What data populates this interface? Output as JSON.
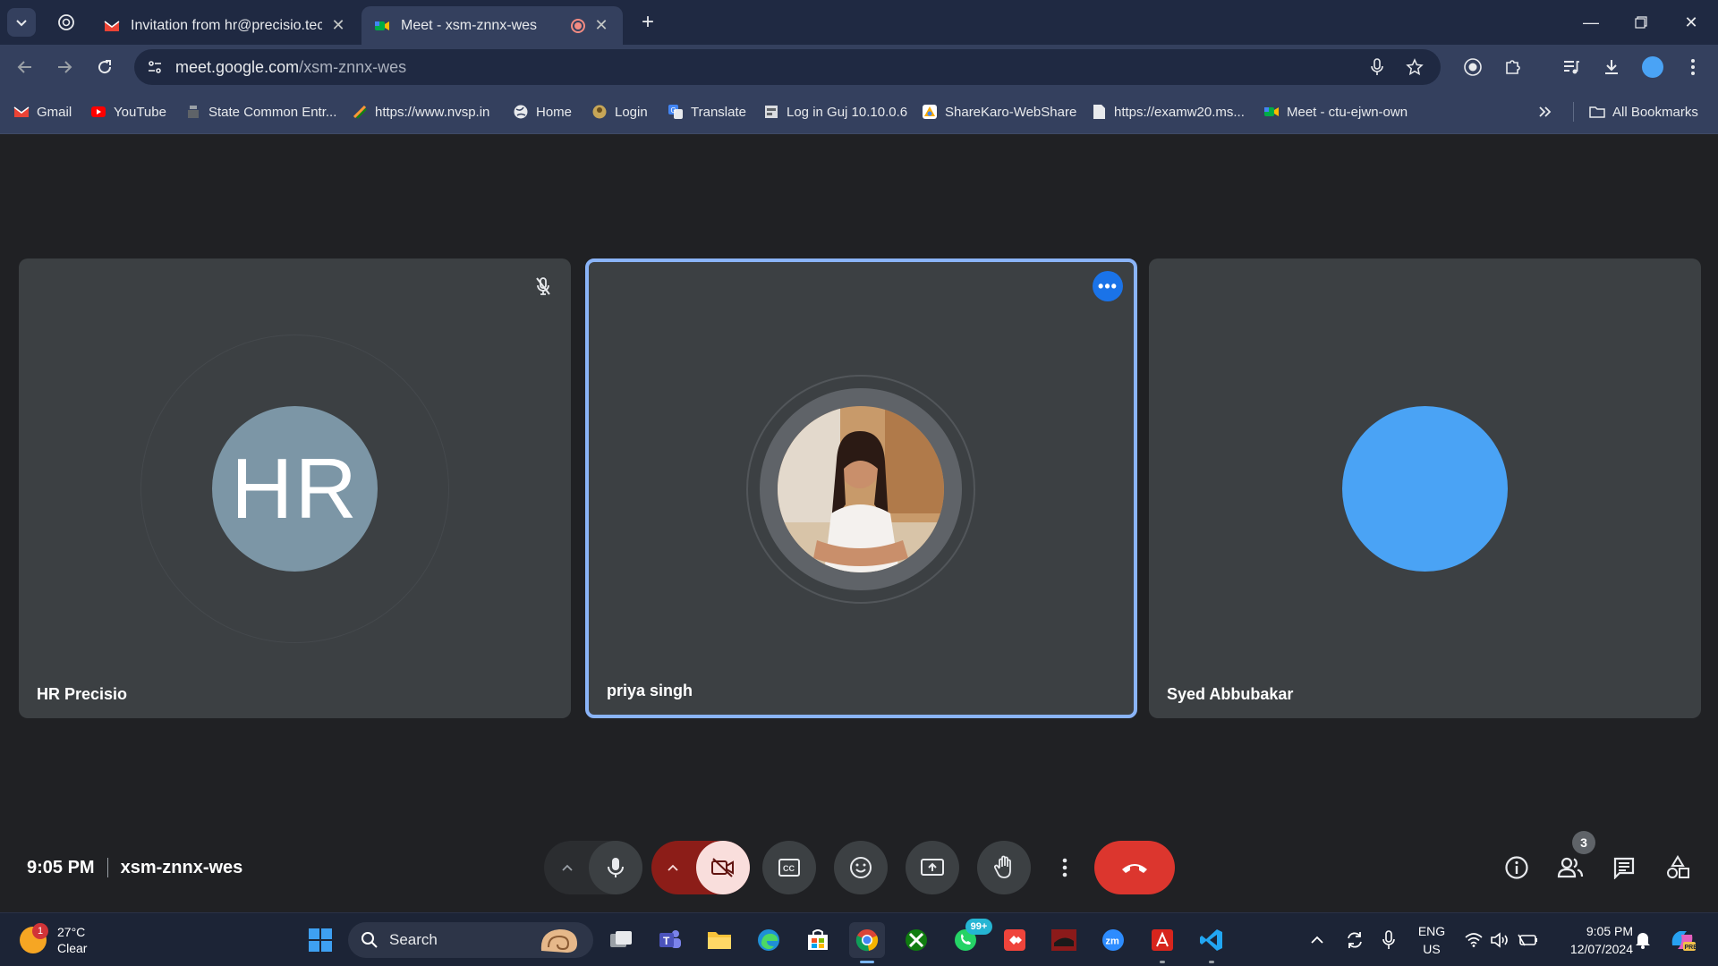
{
  "browser": {
    "tabs": [
      {
        "title": "Invitation from hr@precisio.tech",
        "favicon": "gmail-icon"
      },
      {
        "title": "Meet - xsm-znnx-wes",
        "favicon": "google-meet-icon",
        "recording": true
      }
    ],
    "url_host": "meet.google.com",
    "url_path": "/xsm-znnx-wes",
    "bookmarks": [
      {
        "label": "Gmail",
        "icon": "gmail-icon"
      },
      {
        "label": "YouTube",
        "icon": "youtube-icon"
      },
      {
        "label": "State Common Entr...",
        "icon": "emblem-icon"
      },
      {
        "label": "https://www.nvsp.in",
        "icon": "nvsp-icon"
      },
      {
        "label": "Home",
        "icon": "globe-icon"
      },
      {
        "label": "Login",
        "icon": "login-icon"
      },
      {
        "label": "Translate",
        "icon": "translate-icon"
      },
      {
        "label": "Log in Guj 10.10.0.6",
        "icon": "page-icon"
      },
      {
        "label": "ShareKaro-WebShare",
        "icon": "sharekaro-icon"
      },
      {
        "label": "https://examw20.ms...",
        "icon": "doc-icon"
      },
      {
        "label": "Meet - ctu-ejwn-own",
        "icon": "google-meet-icon"
      }
    ],
    "all_bookmarks_label": "All Bookmarks"
  },
  "meet": {
    "participants": [
      {
        "name": "HR Precisio",
        "initials": "HR",
        "muted": true
      },
      {
        "name": "priya singh",
        "active_speaker": true
      },
      {
        "name": "Syed Abbubakar"
      }
    ],
    "time": "9:05 PM",
    "meeting_code": "xsm-znnx-wes",
    "people_count": "3",
    "colors": {
      "active_border": "#8ab4f8",
      "end_call": "#dc362e",
      "avatar_hr": "#7c96a6",
      "avatar_blue": "#4aa3f5"
    }
  },
  "taskbar": {
    "weather_temp": "27°C",
    "weather_desc": "Clear",
    "weather_badge": "1",
    "search_placeholder": "Search",
    "whatsapp_badge": "99+",
    "lang_line1": "ENG",
    "lang_line2": "US",
    "clock_time": "9:05 PM",
    "clock_date": "12/07/2024"
  }
}
